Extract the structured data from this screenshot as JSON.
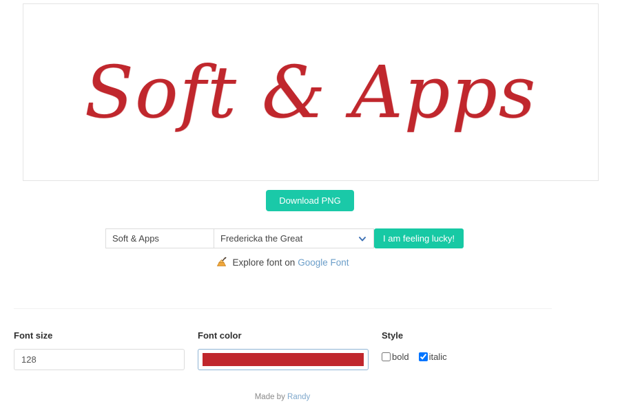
{
  "preview": {
    "text": "Soft & Apps",
    "font_family_name": "Fredericka the Great",
    "font_size": "128",
    "color": "#c0272d",
    "bold": false,
    "italic": true
  },
  "actions": {
    "download_label": "Download PNG",
    "lucky_label": "I am feeling lucky!"
  },
  "form": {
    "text_value": "Soft & Apps",
    "text_placeholder": "Soft & Apps",
    "font_selected": "Fredericka the Great",
    "font_options": [
      "Fredericka the Great"
    ],
    "chevron_icon": "chevron-down-icon"
  },
  "explore": {
    "icon": "writing-hand-icon",
    "label": "Explore font on",
    "link_text": "Google Font"
  },
  "controls": {
    "font_size": {
      "label": "Font size",
      "value": "128",
      "placeholder": "128"
    },
    "font_color": {
      "label": "Font color",
      "value": "#c0272d"
    },
    "style": {
      "label": "Style",
      "options": [
        {
          "name": "bold",
          "label": "bold",
          "checked": false
        },
        {
          "name": "italic",
          "label": "italic",
          "checked": true
        }
      ]
    }
  },
  "footer": {
    "prefix": "Made by ",
    "author": "Randy"
  },
  "theme": {
    "teal": "#1ac9a8",
    "red": "#c0272d",
    "link_blue": "#6b9ec9"
  }
}
